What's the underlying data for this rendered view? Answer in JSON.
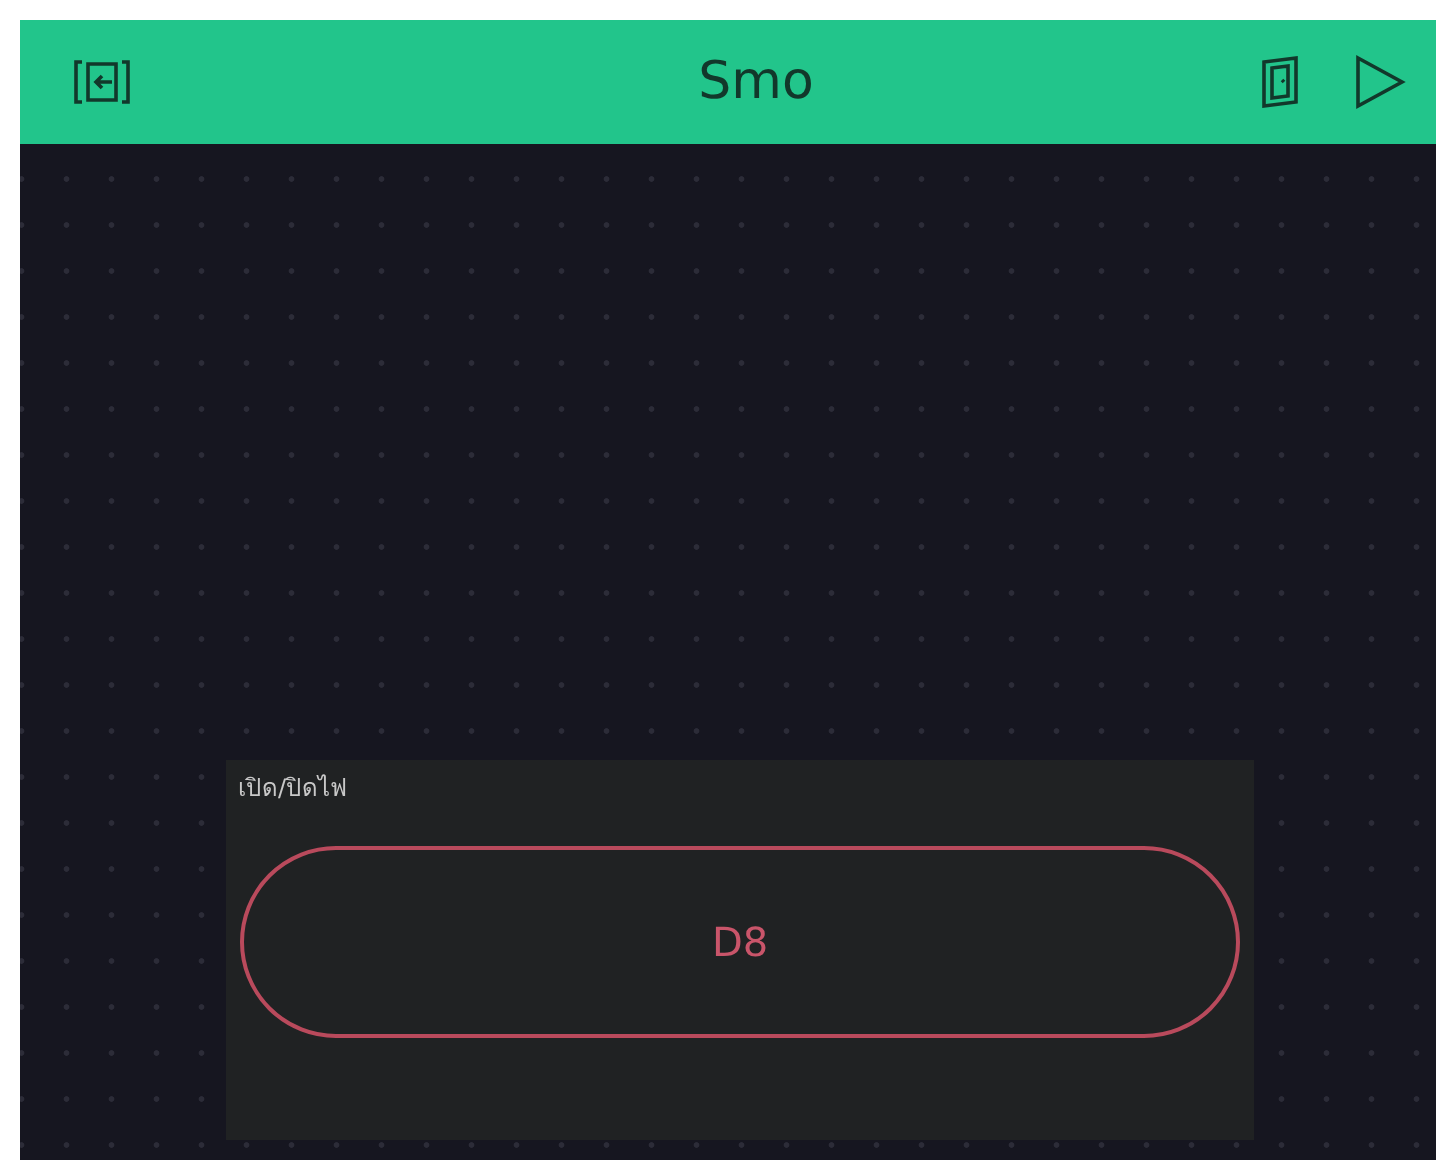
{
  "header": {
    "title": "Smo"
  },
  "widgets": [
    {
      "kind": "button",
      "label": "เปิด/ปิดไฟ",
      "pin": "D8",
      "on": false
    }
  ]
}
